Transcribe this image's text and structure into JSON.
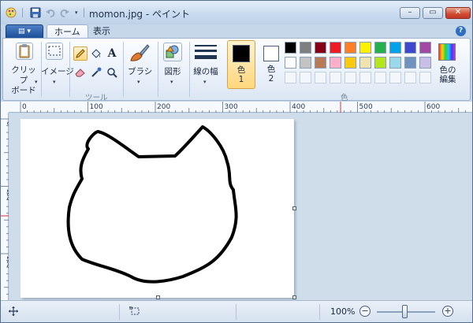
{
  "window": {
    "title": "momon.jpg - ペイント",
    "minimize_glyph": "–",
    "maximize_glyph": "▭",
    "close_glyph": "✕"
  },
  "tabs": {
    "menu_glyph": "▤ ▾",
    "home": "ホーム",
    "view": "表示",
    "help_glyph": "?"
  },
  "ribbon": {
    "clipboard_label": "クリップ\nボード",
    "image_label": "イメージ",
    "tools_group_label": "ツール",
    "brush_label": "ブラシ",
    "shapes_label": "図形",
    "line_width_label": "線の幅",
    "color1_label": "色\n1",
    "color2_label": "色\n2",
    "colors_group_label": "色",
    "edit_colors_label": "色の\n編集",
    "text_tool_glyph": "A",
    "dropdown_glyph": "▾"
  },
  "color1": "#000000",
  "color2": "#ffffff",
  "palette_row1": [
    "#000000",
    "#7f7f7f",
    "#880015",
    "#ed1c24",
    "#ff7f27",
    "#fff200",
    "#22b14c",
    "#00a2e8",
    "#3f48cc",
    "#a349a4"
  ],
  "palette_row2": [
    "#ffffff",
    "#c3c3c3",
    "#b97a57",
    "#ffaec9",
    "#ffc90e",
    "#efe4b0",
    "#b5e61d",
    "#99d9ea",
    "#7092be",
    "#c8bfe7"
  ],
  "ruler": {
    "h_ticks": [
      "0",
      "100",
      "200",
      "300",
      "400",
      "500",
      "600"
    ],
    "v_ticks": [
      "0",
      "100",
      "200"
    ]
  },
  "status": {
    "zoom": "100%",
    "zoom_out_glyph": "−",
    "zoom_in_glyph": "+"
  },
  "icons": {
    "app": "paint-app-icon",
    "save": "save-icon",
    "undo": "undo-icon",
    "redo": "redo-icon",
    "clipboard": "clipboard-icon",
    "select": "select-icon",
    "pencil": "pencil-icon",
    "fill": "fill-icon",
    "text": "text-icon",
    "eraser": "eraser-icon",
    "picker": "color-picker-icon",
    "magnifier": "magnifier-icon",
    "brush": "brush-icon",
    "shapes": "shapes-icon",
    "line_width": "line-width-icon",
    "edit_colors": "rainbow-icon",
    "cursor_pos": "cursor-position-icon",
    "selection_size": "selection-size-icon"
  }
}
